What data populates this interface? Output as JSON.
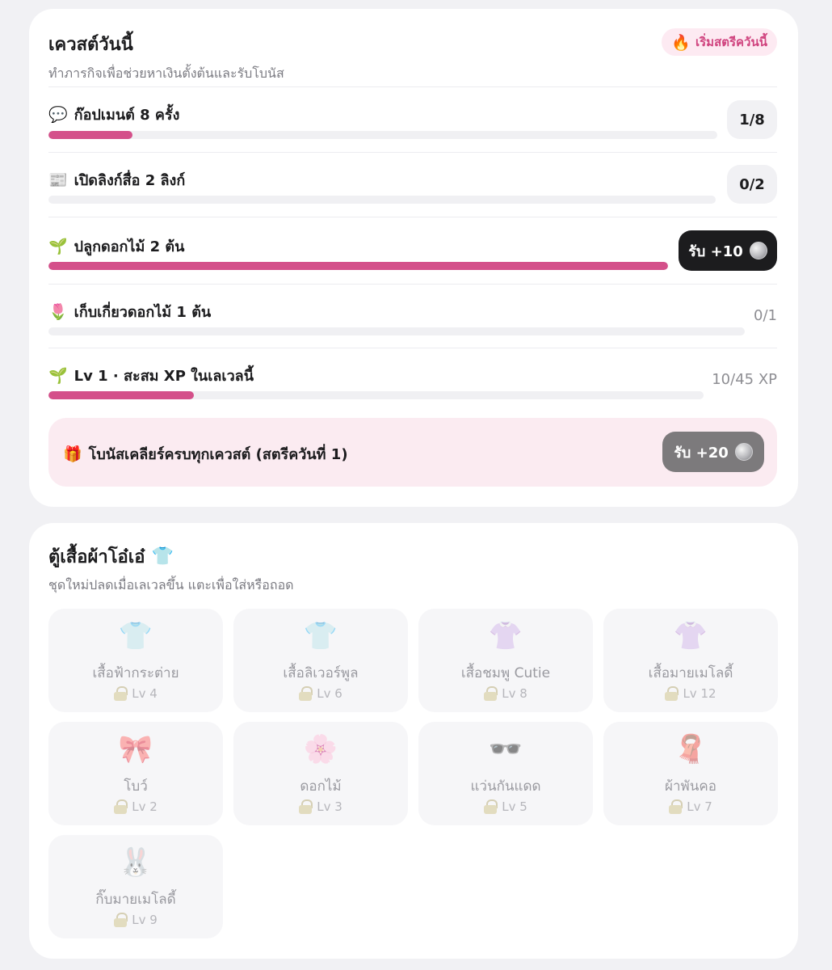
{
  "quests": {
    "title": "เควสต์วันนี้",
    "subtitle": "ทำภารกิจเพื่อช่วยหาเงินตั้งต้นและรับโบนัส",
    "streak_badge": {
      "icon": "fire-icon",
      "emoji": "🔥",
      "label": "เริ่มสตรีควันนี้"
    },
    "items": [
      {
        "emoji": "💬",
        "icon": "speech-bubble-icon",
        "label": "ก๊อปเมนต์ 8 ครั้ง",
        "progress": 0.125,
        "count": "1/8"
      },
      {
        "emoji": "📰",
        "icon": "newspaper-icon",
        "label": "เปิดลิงก์สื่อ 2 ลิงก์",
        "progress": 0.0,
        "count": "0/2"
      },
      {
        "emoji": "🌱",
        "icon": "seedling-icon",
        "label": "ปลูกดอกไม้ 2 ต้น",
        "progress": 1.0,
        "claim": "รับ +10"
      },
      {
        "emoji": "🌷",
        "icon": "tulip-icon",
        "label": "เก็บเกี่ยวดอกไม้ 1 ต้น",
        "progress": 0.0,
        "count": "0/1"
      },
      {
        "emoji": "🌱",
        "icon": "seedling-icon",
        "label": "Lv 1 · สะสม XP ในเลเวลนี้",
        "progress": 0.222,
        "count": "10/45 XP"
      }
    ],
    "bonus": {
      "emoji": "🎁",
      "icon": "gift-icon",
      "label": "โบนัสเคลียร์ครบทุกเควสต์ (สตรีควันที่ 1)",
      "claim": "รับ +20"
    },
    "colors": {
      "accent": "#d4508a",
      "claim_active": "#1c1c1e",
      "claim_bonus": "#7c7a7c"
    }
  },
  "closet": {
    "title": "ตู้เสื้อผ้าโอ๋เอ๋",
    "title_emoji": "👕",
    "subtitle": "ชุดใหม่ปลดเมื่อเลเวลขึ้น แตะเพื่อใส่หรือถอด",
    "items": [
      {
        "icon": "bunny-shirt-icon",
        "emoji": "👕",
        "name": "เสื้อฟ้ากระต่าย",
        "level": "Lv 4"
      },
      {
        "icon": "liverpool-shirt-icon",
        "emoji": "👕",
        "name": "เสื้อลิเวอร์พูล",
        "level": "Lv 6"
      },
      {
        "icon": "pink-shirt-icon",
        "emoji": "👚",
        "name": "เสื้อชมพู Cutie",
        "level": "Lv 8"
      },
      {
        "icon": "melody-shirt-icon",
        "emoji": "👚",
        "name": "เสื้อมายเมโลดี้",
        "level": "Lv 12"
      },
      {
        "icon": "bow-icon",
        "emoji": "🎀",
        "name": "โบว์",
        "level": "Lv 2"
      },
      {
        "icon": "flower-icon",
        "emoji": "🌸",
        "name": "ดอกไม้",
        "level": "Lv 3"
      },
      {
        "icon": "sunglasses-icon",
        "emoji": "🕶️",
        "name": "แว่นกันแดด",
        "level": "Lv 5"
      },
      {
        "icon": "scarf-icon",
        "emoji": "🧣",
        "name": "ผ้าพันคอ",
        "level": "Lv 7"
      },
      {
        "icon": "melody-clip-icon",
        "emoji": "🐰",
        "name": "กิ๊บมายเมโลดี้",
        "level": "Lv 9"
      }
    ]
  }
}
